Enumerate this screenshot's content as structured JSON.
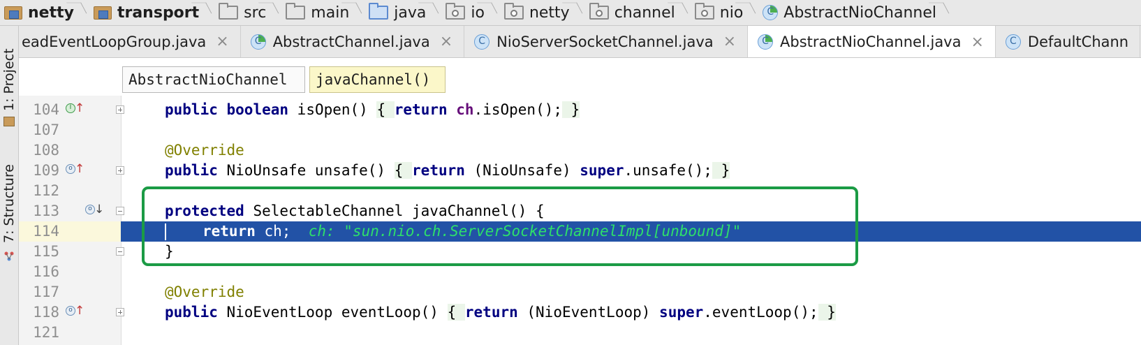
{
  "breadcrumbs": [
    {
      "label": "netty",
      "icon": "module-icon",
      "bold": true
    },
    {
      "label": "transport",
      "icon": "module-icon",
      "bold": true
    },
    {
      "label": "src",
      "icon": "folder-icon"
    },
    {
      "label": "main",
      "icon": "folder-icon"
    },
    {
      "label": "java",
      "icon": "source-folder-icon"
    },
    {
      "label": "io",
      "icon": "package-icon"
    },
    {
      "label": "netty",
      "icon": "package-icon"
    },
    {
      "label": "channel",
      "icon": "package-icon"
    },
    {
      "label": "nio",
      "icon": "package-icon"
    },
    {
      "label": "AbstractNioChannel",
      "icon": "abstract-class-icon"
    }
  ],
  "tool_windows": {
    "project": "1: Project",
    "structure": "7: Structure"
  },
  "tabs": [
    {
      "label": "eadEventLoopGroup.java",
      "icon": "none",
      "closable": true,
      "active": false
    },
    {
      "label": "AbstractChannel.java",
      "icon": "abstract-class-icon",
      "closable": true,
      "active": false
    },
    {
      "label": "NioServerSocketChannel.java",
      "icon": "class-icon",
      "closable": true,
      "active": false
    },
    {
      "label": "AbstractNioChannel.java",
      "icon": "abstract-class-icon",
      "closable": true,
      "active": true
    },
    {
      "label": "DefaultChann",
      "icon": "class-icon",
      "closable": false,
      "active": false
    }
  ],
  "close_glyph": "×",
  "class_icon_letter": "C",
  "structure": {
    "class_name": "AbstractNioChannel",
    "method_name": "javaChannel()"
  },
  "editor": {
    "lines": [
      {
        "num": "104",
        "code": "public boolean isOpen() { return ch.isOpen(); }"
      },
      {
        "num": "107",
        "code": ""
      },
      {
        "num": "108",
        "code": "@Override"
      },
      {
        "num": "109",
        "code": "public NioUnsafe unsafe() { return (NioUnsafe) super.unsafe(); }"
      },
      {
        "num": "112",
        "code": ""
      },
      {
        "num": "113",
        "code": "protected SelectableChannel javaChannel() {"
      },
      {
        "num": "114",
        "code": "return ch;",
        "debug_value": "ch: \"sun.nio.ch.ServerSocketChannelImpl[unbound]\""
      },
      {
        "num": "115",
        "code": "}"
      },
      {
        "num": "116",
        "code": ""
      },
      {
        "num": "117",
        "code": "@Override"
      },
      {
        "num": "118",
        "code": "public NioEventLoop eventLoop() { return (NioEventLoop) super.eventLoop(); }"
      },
      {
        "num": "121",
        "code": ""
      }
    ],
    "selected_line": "114",
    "highlight_box_color": "#1b9b45",
    "selection_color": "#2252a6"
  }
}
